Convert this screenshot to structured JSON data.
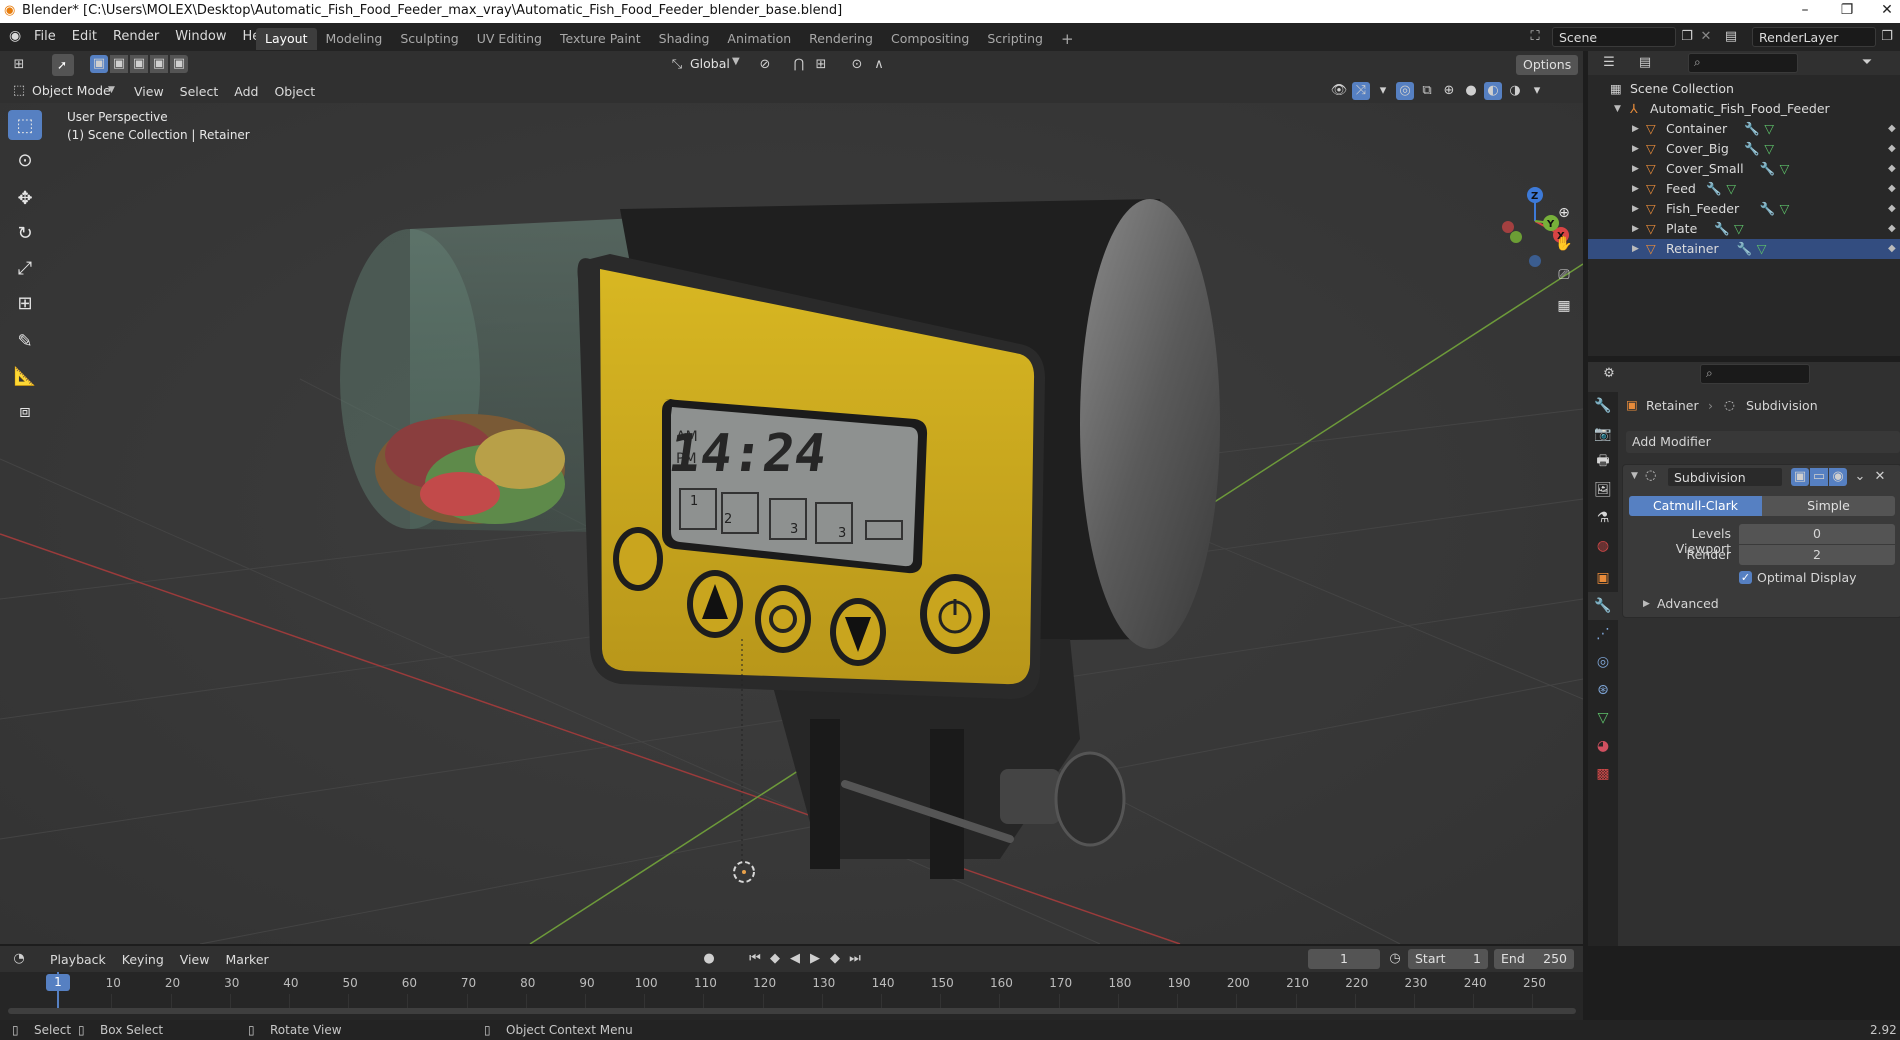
{
  "window": {
    "title": "Blender* [C:\\Users\\MOLEX\\Desktop\\Automatic_Fish_Food_Feeder_max_vray\\Automatic_Fish_Food_Feeder_blender_base.blend]",
    "minimize": "–",
    "restore": "❐",
    "close": "✕"
  },
  "menu": [
    "File",
    "Edit",
    "Render",
    "Window",
    "Help"
  ],
  "workspaces": [
    "Layout",
    "Modeling",
    "Sculpting",
    "UV Editing",
    "Texture Paint",
    "Shading",
    "Animation",
    "Rendering",
    "Compositing",
    "Scripting"
  ],
  "workspace_add": "+",
  "scene": {
    "name": "Scene",
    "view_layer": "RenderLayer"
  },
  "tool_header": {
    "orientation": "Global",
    "options": "Options"
  },
  "viewport_header": {
    "mode": "Object Mode",
    "menus": [
      "View",
      "Select",
      "Add",
      "Object"
    ]
  },
  "viewport": {
    "perspective": "User Perspective",
    "collection_info": "(1) Scene Collection | Retainer",
    "lcd": {
      "am": "AM",
      "pm": "PM",
      "time": "14:24",
      "slots": [
        "1",
        "2",
        "3",
        "3"
      ]
    },
    "gizmo": {
      "x": "X",
      "y": "Y",
      "z": "Z"
    }
  },
  "outliner": {
    "root": "Scene Collection",
    "collection": "Automatic_Fish_Food_Feeder",
    "objects": [
      "Container",
      "Cover_Big",
      "Cover_Small",
      "Feed",
      "Fish_Feeder",
      "Plate",
      "Retainer"
    ],
    "active": "Retainer"
  },
  "properties": {
    "object": "Retainer",
    "breadcrumb_sep": "›",
    "modifier_crumb": "Subdivision",
    "add_modifier": "Add Modifier",
    "modifier": {
      "name": "Subdivision",
      "algorithms": [
        "Catmull-Clark",
        "Simple"
      ],
      "active_algorithm": "Catmull-Clark",
      "levels_viewport_label": "Levels Viewport",
      "levels_viewport": "0",
      "render_label": "Render",
      "render": "2",
      "optimal_display_label": "Optimal Display",
      "optimal_display": true,
      "advanced": "Advanced"
    }
  },
  "timeline": {
    "menus": [
      "Playback",
      "Keying",
      "View",
      "Marker"
    ],
    "current_frame": "1",
    "start_label": "Start",
    "start": "1",
    "end_label": "End",
    "end": "250",
    "ticks": [
      "1",
      "10",
      "20",
      "30",
      "40",
      "50",
      "60",
      "70",
      "80",
      "90",
      "100",
      "110",
      "120",
      "130",
      "140",
      "150",
      "160",
      "170",
      "180",
      "190",
      "200",
      "210",
      "220",
      "230",
      "240",
      "250"
    ]
  },
  "statusbar": {
    "select": "Select",
    "box_select": "Box Select",
    "rotate_view": "Rotate View",
    "context_menu": "Object Context Menu",
    "version": "2.92"
  },
  "colors": {
    "accent": "#5680c2",
    "object_orange": "#e88b3a",
    "mesh_green": "#5ec26a",
    "wrench_blue": "#7fa6d8",
    "feeder_yellow": "#d6b21e"
  }
}
